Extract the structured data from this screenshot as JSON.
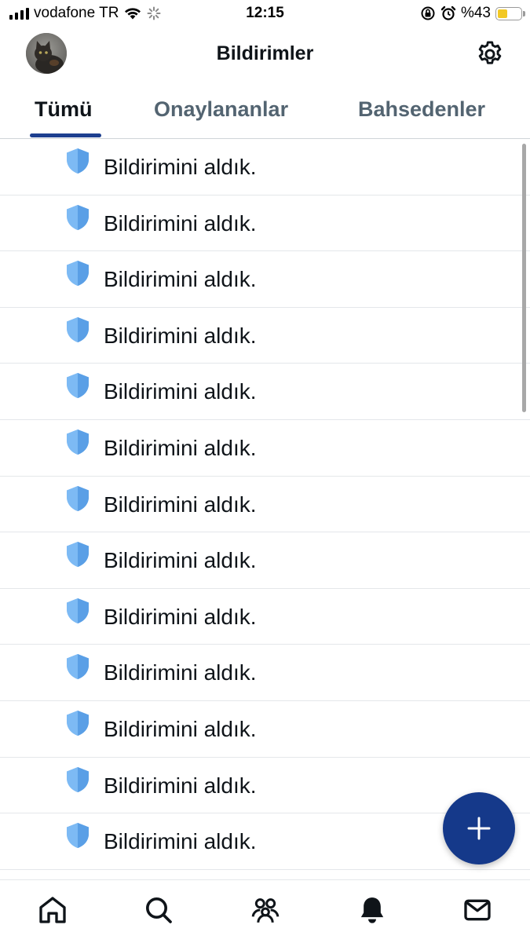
{
  "status_bar": {
    "carrier": "vodafone TR",
    "time": "12:15",
    "battery_percent_label": "%43",
    "battery_level": 0.43,
    "battery_color": "#f2c824"
  },
  "header": {
    "title": "Bildirimler",
    "avatar_icon": "cat-photo-avatar",
    "settings_icon": "gear-icon"
  },
  "tabs": [
    {
      "label": "Tümü",
      "active": true
    },
    {
      "label": "Onaylananlar",
      "active": false
    },
    {
      "label": "Bahsedenler",
      "active": false
    }
  ],
  "accent_color": "#15398a",
  "notifications": [
    {
      "icon": "shield-icon",
      "text": "Bildirimini aldık."
    },
    {
      "icon": "shield-icon",
      "text": "Bildirimini aldık."
    },
    {
      "icon": "shield-icon",
      "text": "Bildirimini aldık."
    },
    {
      "icon": "shield-icon",
      "text": "Bildirimini aldık."
    },
    {
      "icon": "shield-icon",
      "text": "Bildirimini aldık."
    },
    {
      "icon": "shield-icon",
      "text": "Bildirimini aldık."
    },
    {
      "icon": "shield-icon",
      "text": "Bildirimini aldık."
    },
    {
      "icon": "shield-icon",
      "text": "Bildirimini aldık."
    },
    {
      "icon": "shield-icon",
      "text": "Bildirimini aldık."
    },
    {
      "icon": "shield-icon",
      "text": "Bildirimini aldık."
    },
    {
      "icon": "shield-icon",
      "text": "Bildirimini aldık."
    },
    {
      "icon": "shield-icon",
      "text": "Bildirimini aldık."
    },
    {
      "icon": "shield-icon",
      "text": "Bildirimini aldık."
    }
  ],
  "fab_icon": "plus-icon",
  "bottom_nav": [
    {
      "icon": "home-icon",
      "active": false
    },
    {
      "icon": "search-icon",
      "active": false
    },
    {
      "icon": "communities-icon",
      "active": false
    },
    {
      "icon": "bell-icon",
      "active": true
    },
    {
      "icon": "mail-icon",
      "active": false
    }
  ]
}
